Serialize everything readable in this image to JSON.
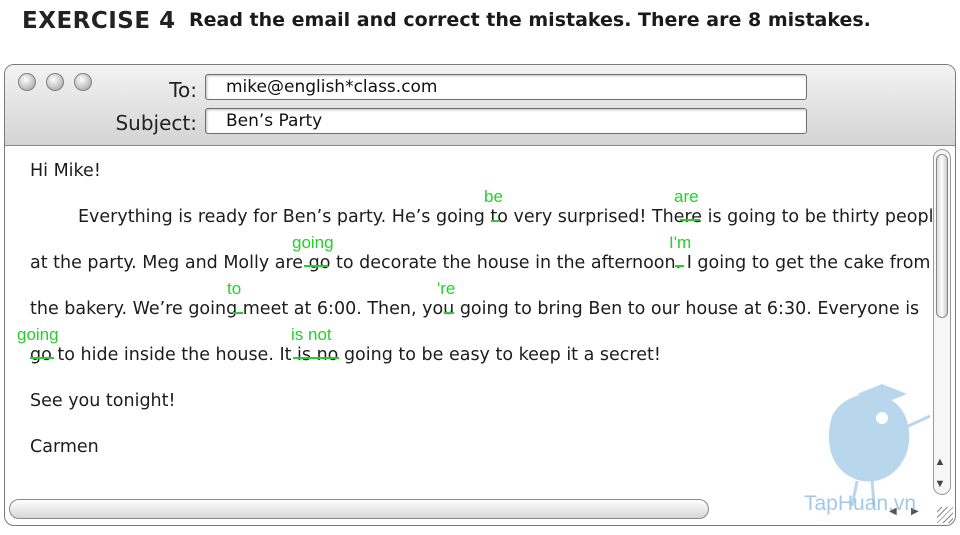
{
  "header": {
    "exercise": "EXERCISE 4",
    "instruction": "Read the email and correct the mistakes. There are 8 mistakes."
  },
  "email": {
    "to_label": "To:",
    "to_value": "mike@english*class.com",
    "subject_label": "Subject:",
    "subject_value": "Ben’s Party",
    "greeting": "Hi Mike!",
    "lines": [
      "Everything is ready for Ben’s party. He’s going to very surprised! There is going to be thirty people",
      "at the party. Meg and Molly are go to decorate the house in the afternoon. I going to get the cake from",
      "the bakery. We’re going meet at 6:00. Then, you going to bring Ben to our house at 6:30. Everyone is",
      "go to hide inside the house. It is no going to be easy to keep it a secret!"
    ],
    "closing": "See you tonight!",
    "signature": "Carmen"
  },
  "corrections": [
    "be",
    "are",
    "going",
    "I'm",
    "to",
    "'re",
    "going",
    "is not"
  ],
  "watermark": "TapHuan.vn",
  "colors": {
    "correction": "#22d12a",
    "watermark": "#7fb8e0"
  }
}
